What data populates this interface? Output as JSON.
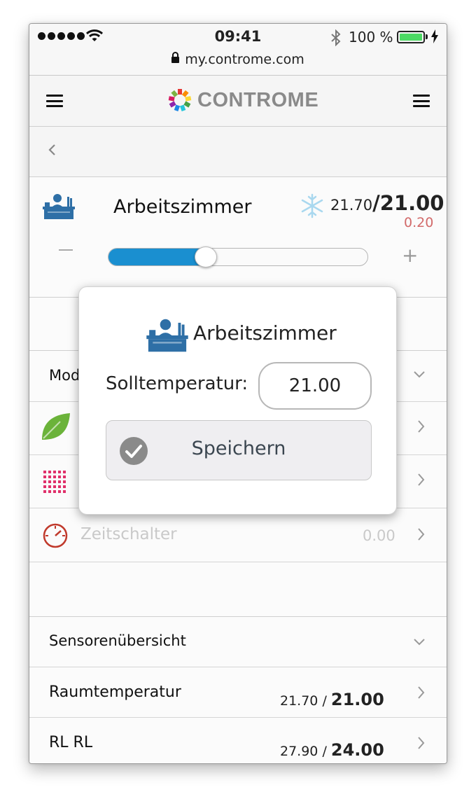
{
  "status_bar": {
    "time": "09:41",
    "battery": "100 %",
    "url": "my.controme.com"
  },
  "header": {
    "logo_text": "CONTROME"
  },
  "room": {
    "name": "Arbeitszimmer",
    "current_temp": "21.70",
    "target_temp": "21.00",
    "difference": "0.20",
    "slider_fraction": 0.37
  },
  "rows": {
    "mode_label": "Mod",
    "timer_label": "Zeitschalter",
    "timer_value": "0.00",
    "sensor_overview_label": "Sensorenübersicht"
  },
  "sensors": [
    {
      "name": "Raumtemperatur",
      "value": "21.70",
      "sep": " / ",
      "target": "21.00"
    },
    {
      "name": "RL RL",
      "value": "27.90",
      "sep": " / ",
      "target": "24.00"
    }
  ],
  "modal": {
    "title": "Arbeitszimmer",
    "setpoint_label": "Solltemperatur:",
    "setpoint_value": "21.00",
    "save_label": "Speichern"
  },
  "colors": {
    "accent": "#1a8fd0",
    "delta": "#d26a6a",
    "leaf": "#6bb33a",
    "grid": "#e0306a",
    "timer": "#c0392b"
  },
  "icons": [
    "hamburger-icon",
    "back-chevron-icon",
    "desk-icon",
    "snowflake-icon",
    "leaf-icon",
    "grid-icon",
    "timer-icon",
    "chevron-right-icon",
    "chevron-down-icon",
    "check-icon"
  ]
}
